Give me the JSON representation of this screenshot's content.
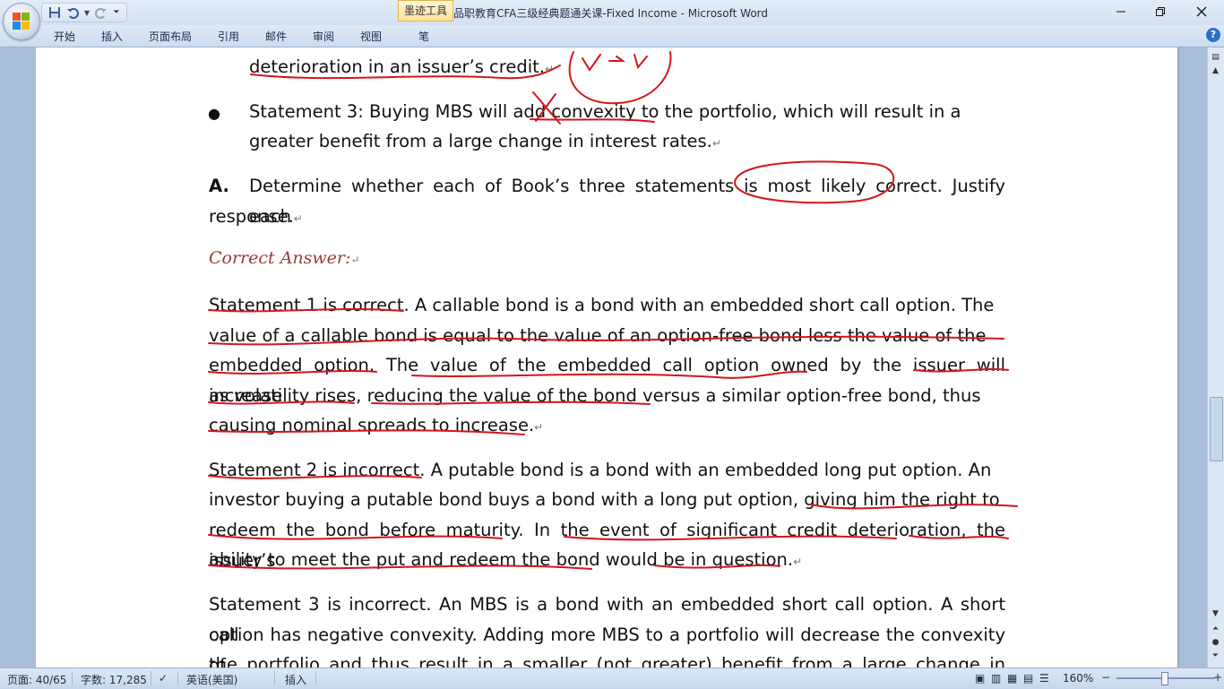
{
  "window": {
    "title": "品职教育CFA三级经典题通关课-Fixed Income - Microsoft Word",
    "contextual_tab": "墨迹工具"
  },
  "qat": {
    "save_icon": "save-icon",
    "undo_icon": "undo-icon",
    "redo_icon": "redo-icon",
    "customize_icon": "customize-icon"
  },
  "ribbon": {
    "tabs": [
      "开始",
      "插入",
      "页面布局",
      "引用",
      "邮件",
      "审阅",
      "视图",
      "笔"
    ]
  },
  "document": {
    "line_top": "deterioration in an issuer’s credit.",
    "statement3_a": "Statement 3: Buying MBS will add convexity to the portfolio, which will result in a",
    "statement3_b": "greater benefit from a large change in interest rates.",
    "question_a_label": "A.",
    "question_a_a": "Determine whether each of Book’s three statements is most likely correct. Justify each",
    "question_a_b": "response.",
    "answer_label": "Correct Answer:",
    "p1_l1": "Statement 1 is correct. A callable bond is a bond with an embedded short call option. The",
    "p1_l2": "value of a callable bond is equal to the value of an option-free bond less the value of the",
    "p1_l3": "embedded option. The value of the embedded call option owned by the issuer will increase",
    "p1_l4": "as volatility rises, reducing the value of the bond versus a similar option-free bond, thus",
    "p1_l5": "causing nominal spreads to increase.",
    "p2_l1": "Statement 2 is incorrect. A putable bond is a bond with an embedded long put option. An",
    "p2_l2": "investor buying a putable bond buys a bond with a long put option, giving him the right to",
    "p2_l3": "redeem the bond before maturity. In the event of significant credit deterioration, the issuer’s",
    "p2_l4": "ability to meet the put and redeem the bond would be in question.",
    "p3_l1": "Statement 3 is incorrect. An MBS is a bond with an embedded short call option. A short call",
    "p3_l2": "option has negative convexity. Adding more MBS to a portfolio will decrease the convexity of",
    "p3_l3": "the portfolio and thus result in a smaller (not greater) benefit from a large change in interest",
    "paragraph_mark": "↵"
  },
  "status": {
    "page": "页面: 40/65",
    "words": "字数: 17,285",
    "language": "英语(美国)",
    "mode": "插入",
    "zoom": "160%",
    "zoom_minus": "−",
    "zoom_plus": "+"
  },
  "colors": {
    "ink": "#d4161b",
    "answer_label": "#9b3b34",
    "ribbon_bg": "#dfe9f6"
  }
}
